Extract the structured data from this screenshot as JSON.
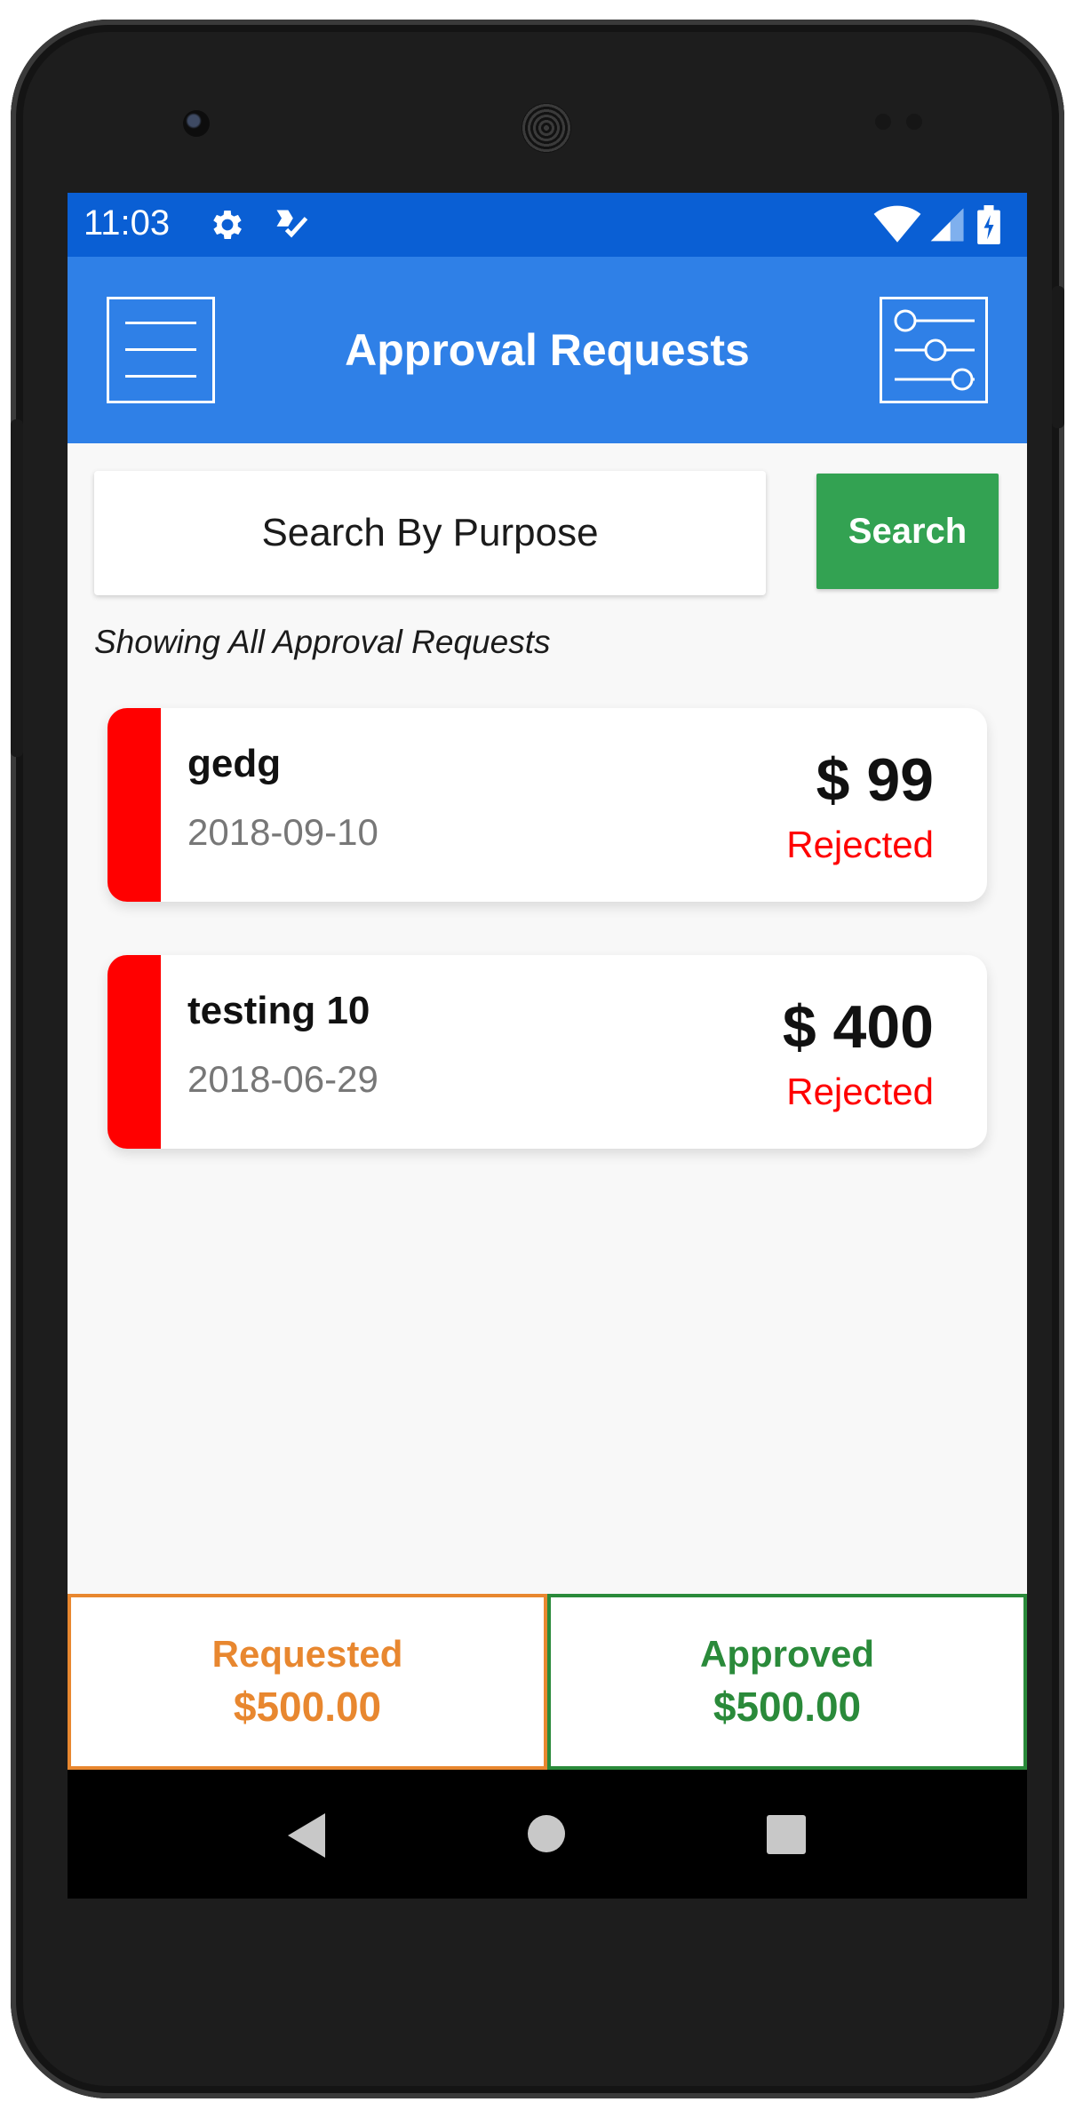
{
  "status_bar": {
    "time": "11:03",
    "left_icons": [
      "gear-icon",
      "task-check-icon"
    ],
    "right_icons": [
      "wifi-icon",
      "signal-icon",
      "battery-charging-icon"
    ]
  },
  "app_bar": {
    "title": "Approval Requests",
    "menu_icon": "hamburger-menu-icon",
    "filter_icon": "sliders-filter-icon"
  },
  "search": {
    "placeholder": "Search By Purpose",
    "button_label": "Search"
  },
  "list_caption": "Showing All Approval Requests",
  "requests": [
    {
      "purpose": "gedg",
      "date": "2018-09-10",
      "amount": "$ 99",
      "status": "Rejected"
    },
    {
      "purpose": "testing 10",
      "date": "2018-06-29",
      "amount": "$ 400",
      "status": "Rejected"
    }
  ],
  "summary": {
    "requested_label": "Requested",
    "requested_value": "$500.00",
    "approved_label": "Approved",
    "approved_value": "$500.00"
  },
  "colors": {
    "status_bar": "#0a5fd4",
    "app_bar": "#2f80e7",
    "search_button": "#33a252",
    "rejected": "#ff0000",
    "requested": "#e8872f",
    "approved": "#2a8a3a"
  },
  "nav_bar": {
    "icons": [
      "back-icon",
      "home-icon",
      "recent-apps-icon"
    ]
  }
}
